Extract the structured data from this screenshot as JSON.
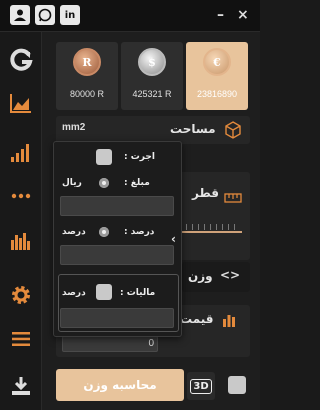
{
  "titlebar": {
    "minimize": "–",
    "close": "×",
    "icons": [
      "user-icon",
      "whatsapp-icon",
      "linkedin-icon"
    ]
  },
  "sidebar": {
    "items": [
      "logo-icon",
      "chart-area-icon",
      "signal-bars-icon",
      "more-dots-icon",
      "bar-chart-icon",
      "gear-icon",
      "menu-icon",
      "download-icon"
    ]
  },
  "coins": [
    {
      "symbol": "R",
      "value": "80000 R"
    },
    {
      "symbol": "$",
      "value": "425321 R"
    },
    {
      "symbol": "€",
      "value": "23816890"
    }
  ],
  "area": {
    "label": "مساحت",
    "unit": "mm2"
  },
  "diameter": {
    "label": "قطر"
  },
  "weight": {
    "label": "وزن"
  },
  "price": {
    "label": "قیمت",
    "value": "0"
  },
  "popup": {
    "wage_label": "اجرت :",
    "amount_label": "مبلغ :",
    "rial_label": "ریال",
    "percent_label": "درصد :",
    "percent_radio_label": "درصد",
    "tax_label": "مالیات :",
    "tax_unit": "درصد"
  },
  "calc_button": "محاسبه وزن",
  "view3d_label": "3D",
  "colors": {
    "accent": "#e8c49c",
    "active_icon": "#e48a3c",
    "panel": "#262626"
  }
}
